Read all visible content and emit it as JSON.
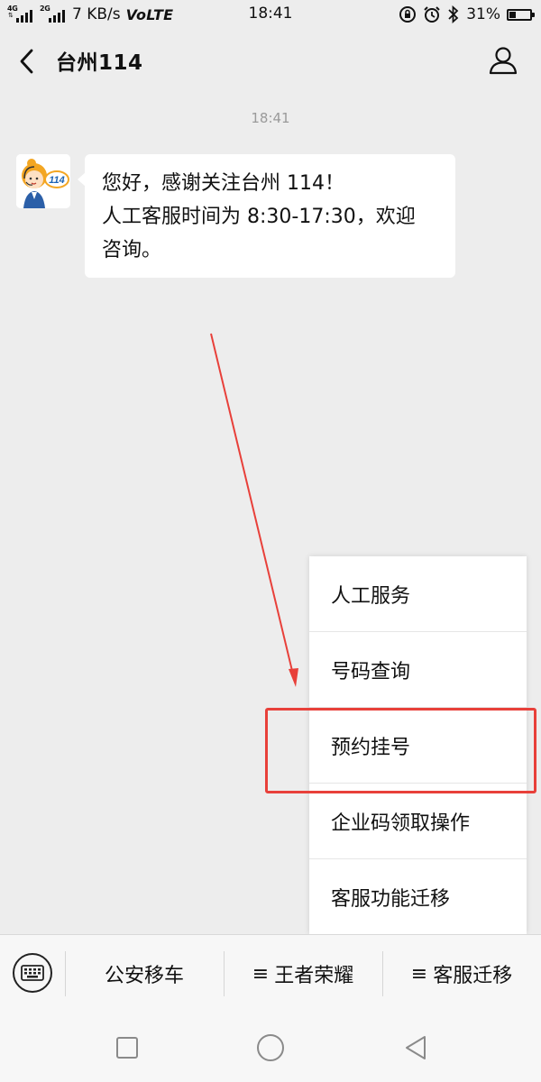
{
  "status_bar": {
    "network_tag_1": "4G",
    "network_tag_2": "2G",
    "speed": "7 KB/s",
    "volte": "VoLTE",
    "time": "18:41",
    "battery": "31%",
    "battery_level": 0.31
  },
  "header": {
    "title": "台州114",
    "back_icon": "chevron-left-icon",
    "profile_icon": "user-icon"
  },
  "chat": {
    "timestamp": "18:41",
    "message": {
      "line1": "您好，感谢关注台州 114！",
      "line2": "人工客服时间为 8:30-17:30，欢迎",
      "line3": "咨询。"
    },
    "avatar_badge": "114"
  },
  "popup_menu": {
    "items": [
      {
        "label": "人工服务"
      },
      {
        "label": "号码查询"
      },
      {
        "label": "预约挂号"
      },
      {
        "label": "企业码领取操作"
      },
      {
        "label": "客服功能迁移"
      }
    ],
    "highlighted_index": 2
  },
  "bottom_menu": {
    "keyboard_icon": "keyboard-icon",
    "tabs": [
      {
        "label": "公安移车",
        "prefix": ""
      },
      {
        "label": "王者荣耀",
        "prefix": "≡"
      },
      {
        "label": "客服迁移",
        "prefix": "≡"
      }
    ]
  },
  "annotation": {
    "color": "#e8403a"
  },
  "nav_bar": {
    "recent_icon": "square-icon",
    "home_icon": "circle-icon",
    "back_icon": "triangle-back-icon"
  }
}
